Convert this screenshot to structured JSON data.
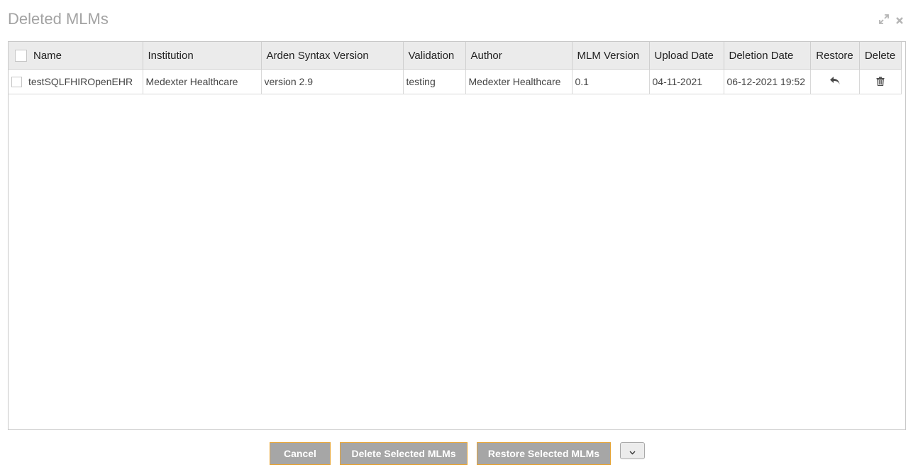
{
  "dialog": {
    "title": "Deleted MLMs"
  },
  "table": {
    "headers": {
      "name": "Name",
      "institution": "Institution",
      "arden": "Arden Syntax Version",
      "validation": "Validation",
      "author": "Author",
      "mlm_version": "MLM Version",
      "upload_date": "Upload Date",
      "deletion_date": "Deletion Date",
      "restore": "Restore",
      "delete": "Delete"
    },
    "rows": [
      {
        "name": "testSQLFHIROpenEHR",
        "institution": "Medexter Healthcare",
        "arden": "version 2.9",
        "validation": "testing",
        "author": "Medexter Healthcare",
        "mlm_version": "0.1",
        "upload_date": "04-11-2021",
        "deletion_date": "06-12-2021 19:52",
        "restore_icon": "undo-arrow-icon",
        "delete_icon": "trash-icon"
      }
    ]
  },
  "footer": {
    "cancel_label": "Cancel",
    "delete_selected_label": "Delete Selected MLMs",
    "restore_selected_label": "Restore Selected MLMs",
    "more_icon": "chevron-down-icon"
  },
  "colors": {
    "button_bg": "#a6a6a6",
    "button_border": "#e5a437",
    "header_bg": "#ebebeb",
    "title_color": "#a3a3a3"
  }
}
